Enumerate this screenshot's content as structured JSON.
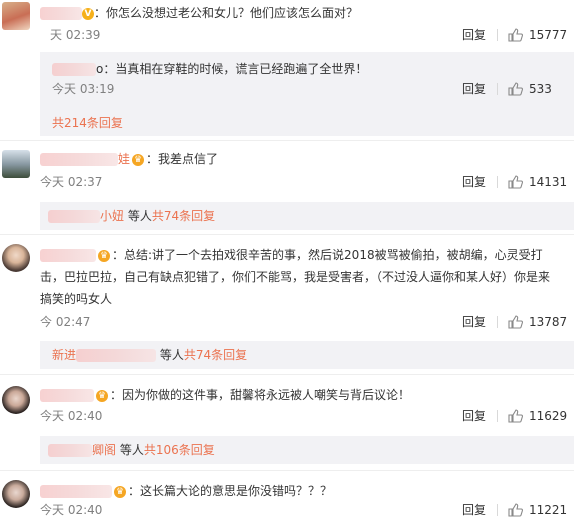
{
  "labels": {
    "reply": "回复",
    "others": "等人"
  },
  "comments": [
    {
      "text": "：你怎么没想过老公和女儿？他们应该怎么面对？",
      "time": "天 02:39",
      "likes": "15777"
    },
    {
      "text": "o：当真相在穿鞋的时候，谎言已经跑遍了全世界！",
      "time": "今天 03:19",
      "likes": "533"
    },
    {
      "more": "共214条回复"
    },
    {
      "name_tail": "娃",
      "text": "：我差点信了",
      "time": "今天 02:37",
      "likes": "14131"
    },
    {
      "name_tail": "小妞",
      "more": "共74条回复"
    },
    {
      "text_line1": "：总结:讲了一个去拍戏很辛苦的事，然后说2018被骂被偷拍，被胡编，心灵受打",
      "text_line2": "击，巴拉巴拉，自己有缺点犯错了，你们不能骂，我是受害者，（不过没人逼你和某人好）你是来",
      "text_line3": "搞笑的吗女人",
      "time": "今  02:47",
      "likes": "13787"
    },
    {
      "name_head": "新进",
      "more": "共74条回复"
    },
    {
      "text": "：因为你做的这件事，甜馨将永远被人嘲笑与背后议论！",
      "time": "今天 02:40",
      "likes": "11629"
    },
    {
      "name_tail": "卿阁",
      "more": "共106条回复"
    },
    {
      "text": "：这长篇大论的意思是你没错吗？？？",
      "time": "今天 02:40",
      "likes": "11221"
    }
  ],
  "icons": {
    "like": "thumbs-up-icon",
    "verified": "verified-badge-icon",
    "member": "member-crown-icon"
  },
  "colors": {
    "accent": "#eb7350",
    "meta": "#808080",
    "sub_bg": "#f2f2f5"
  }
}
